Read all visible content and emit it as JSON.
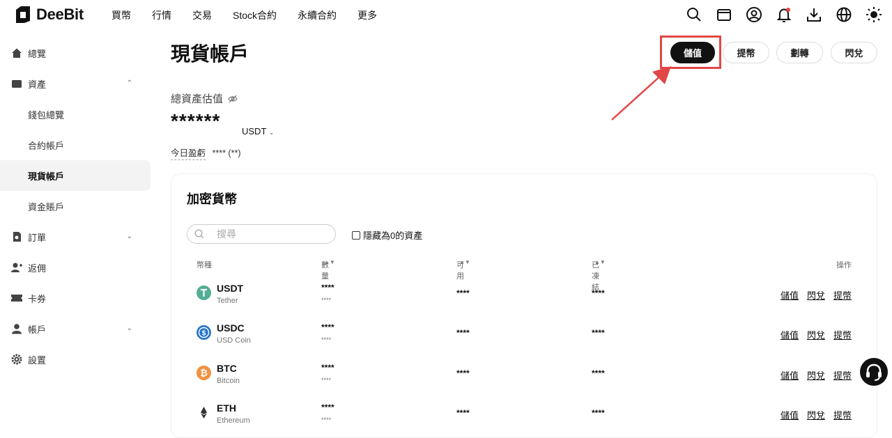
{
  "brand": {
    "name": "DeeBit"
  },
  "topnav": {
    "items": [
      "買幣",
      "行情",
      "交易",
      "Stock合約",
      "永續合約",
      "更多"
    ]
  },
  "sidebar": {
    "items": [
      {
        "label": "總覽"
      },
      {
        "label": "資產"
      },
      {
        "label": "錢包總覽"
      },
      {
        "label": "合約帳戶"
      },
      {
        "label": "現貨帳戶"
      },
      {
        "label": "資金賬戶"
      },
      {
        "label": "訂單"
      },
      {
        "label": "返佣"
      },
      {
        "label": "卡券"
      },
      {
        "label": "帳戶"
      },
      {
        "label": "設置"
      }
    ]
  },
  "page": {
    "title": "現貨帳戶",
    "buttons": {
      "deposit": "儲值",
      "withdraw": "提幣",
      "transfer": "劃轉",
      "convert": "閃兌"
    },
    "total_label": "總資產估值",
    "total_value": "******",
    "unit": "USDT",
    "pnl_label": "今日盈虧",
    "pnl_value": "**** (**)"
  },
  "card": {
    "title": "加密貨幣",
    "search_placeholder": "搜尋",
    "hide_zero": "隱藏為0的資產",
    "headers": {
      "coin": "幣種",
      "amount": "數量",
      "available": "可用",
      "frozen": "已凍結",
      "action": "操作"
    },
    "rows": [
      {
        "symbol": "USDT",
        "name": "Tether",
        "q1": "****",
        "q2": "****",
        "available": "****",
        "frozen": "****",
        "color": "#53ae94"
      },
      {
        "symbol": "USDC",
        "name": "USD Coin",
        "q1": "****",
        "q2": "****",
        "available": "****",
        "frozen": "****",
        "color": "#2775ca"
      },
      {
        "symbol": "BTC",
        "name": "Bitcoin",
        "q1": "****",
        "q2": "****",
        "available": "****",
        "frozen": "****",
        "color": "#f09242"
      },
      {
        "symbol": "ETH",
        "name": "Ethereum",
        "q1": "****",
        "q2": "****",
        "available": "****",
        "frozen": "****",
        "color": "#333333"
      }
    ],
    "row_actions": {
      "deposit": "儲值",
      "convert": "閃兌",
      "withdraw": "提幣"
    }
  }
}
